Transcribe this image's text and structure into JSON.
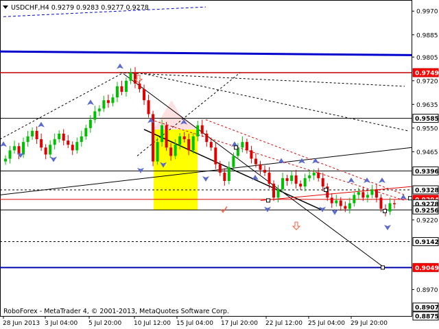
{
  "window": {
    "symbol_line": "USDCHF,H4  0.9279 0.9283 0.9277 0.9278",
    "copyright": "RoboForex - MetaTrader 4, © 2001-2013, MetaQuotes Software Corp."
  },
  "colors": {
    "bull": "#00c000",
    "bear": "#e00000",
    "level_line": "#e00000",
    "trendline": "#000000",
    "channel_main": "#0000cc",
    "arrow_marker": "#5a6acf",
    "highlight": "#ffff00",
    "level_label_red_bg": "#ff0000"
  },
  "price_axis": {
    "ticks": [
      "0.9970",
      "0.9885",
      "0.9805",
      "0.9720",
      "0.9635",
      "0.9550",
      "0.9465",
      "0.9220",
      "0.8970"
    ],
    "labels": [
      {
        "text": "0.9749",
        "color": "red"
      },
      {
        "text": "0.9585",
        "color": "black"
      },
      {
        "text": "0.9396",
        "color": "black"
      },
      {
        "text": "0.9328",
        "color": "black"
      },
      {
        "text": "0.9294",
        "color": "red"
      },
      {
        "text": "0.9278",
        "color": "black"
      },
      {
        "text": "0.9256",
        "color": "black"
      },
      {
        "text": "0.9142",
        "color": "black"
      },
      {
        "text": "0.9049",
        "color": "red"
      },
      {
        "text": "0.8907",
        "color": "black"
      },
      {
        "text": "0.8875",
        "color": "black"
      }
    ]
  },
  "time_axis": {
    "labels": [
      "28 Jun 2013",
      "3 Jul 04:00",
      "5 Jul 20:00",
      "10 Jul 12:00",
      "15 Jul 04:00",
      "17 Jul 20:00",
      "22 Jul 12:00",
      "25 Jul 04:00",
      "29 Jul 20:00"
    ]
  },
  "chart_data": {
    "type": "candlestick",
    "symbol": "USDCHF",
    "timeframe": "H4",
    "last_bar": {
      "open": 0.9279,
      "high": 0.9283,
      "low": 0.9277,
      "close": 0.9278
    },
    "ylim": [
      0.8875,
      1.001
    ],
    "levels": [
      0.9749,
      0.9585,
      0.9396,
      0.9328,
      0.9294,
      0.9256,
      0.9142,
      0.9049
    ],
    "closes": [
      0.944,
      0.947,
      0.9485,
      0.9455,
      0.95,
      0.952,
      0.954,
      0.951,
      0.948,
      0.9455,
      0.949,
      0.951,
      0.953,
      0.9505,
      0.949,
      0.947,
      0.95,
      0.952,
      0.955,
      0.958,
      0.961,
      0.962,
      0.965,
      0.964,
      0.966,
      0.97,
      0.968,
      0.972,
      0.9749,
      0.971,
      0.969,
      0.965,
      0.96,
      0.943,
      0.95,
      0.956,
      0.948,
      0.945,
      0.949,
      0.952,
      0.951,
      0.947,
      0.952,
      0.956,
      0.953,
      0.95,
      0.948,
      0.942,
      0.939,
      0.936,
      0.941,
      0.945,
      0.948,
      0.95,
      0.947,
      0.944,
      0.942,
      0.94,
      0.939,
      0.935,
      0.93,
      0.933,
      0.937,
      0.936,
      0.938,
      0.935,
      0.934,
      0.937,
      0.938,
      0.939,
      0.937,
      0.934,
      0.93,
      0.928,
      0.929,
      0.927,
      0.926,
      0.928,
      0.931,
      0.932,
      0.93,
      0.931,
      0.933,
      0.93,
      0.926,
      0.925,
      0.928,
      0.9278
    ],
    "timeline_labels": [
      "28 Jun 2013",
      "3 Jul 04:00",
      "5 Jul 20:00",
      "10 Jul 12:00",
      "15 Jul 04:00",
      "17 Jul 20:00",
      "22 Jul 12:00",
      "25 Jul 04:00",
      "29 Jul 20:00"
    ],
    "price_ticks": [
      0.997,
      0.9885,
      0.9805,
      0.972,
      0.9635,
      0.955,
      0.9465,
      0.922,
      0.897
    ]
  }
}
